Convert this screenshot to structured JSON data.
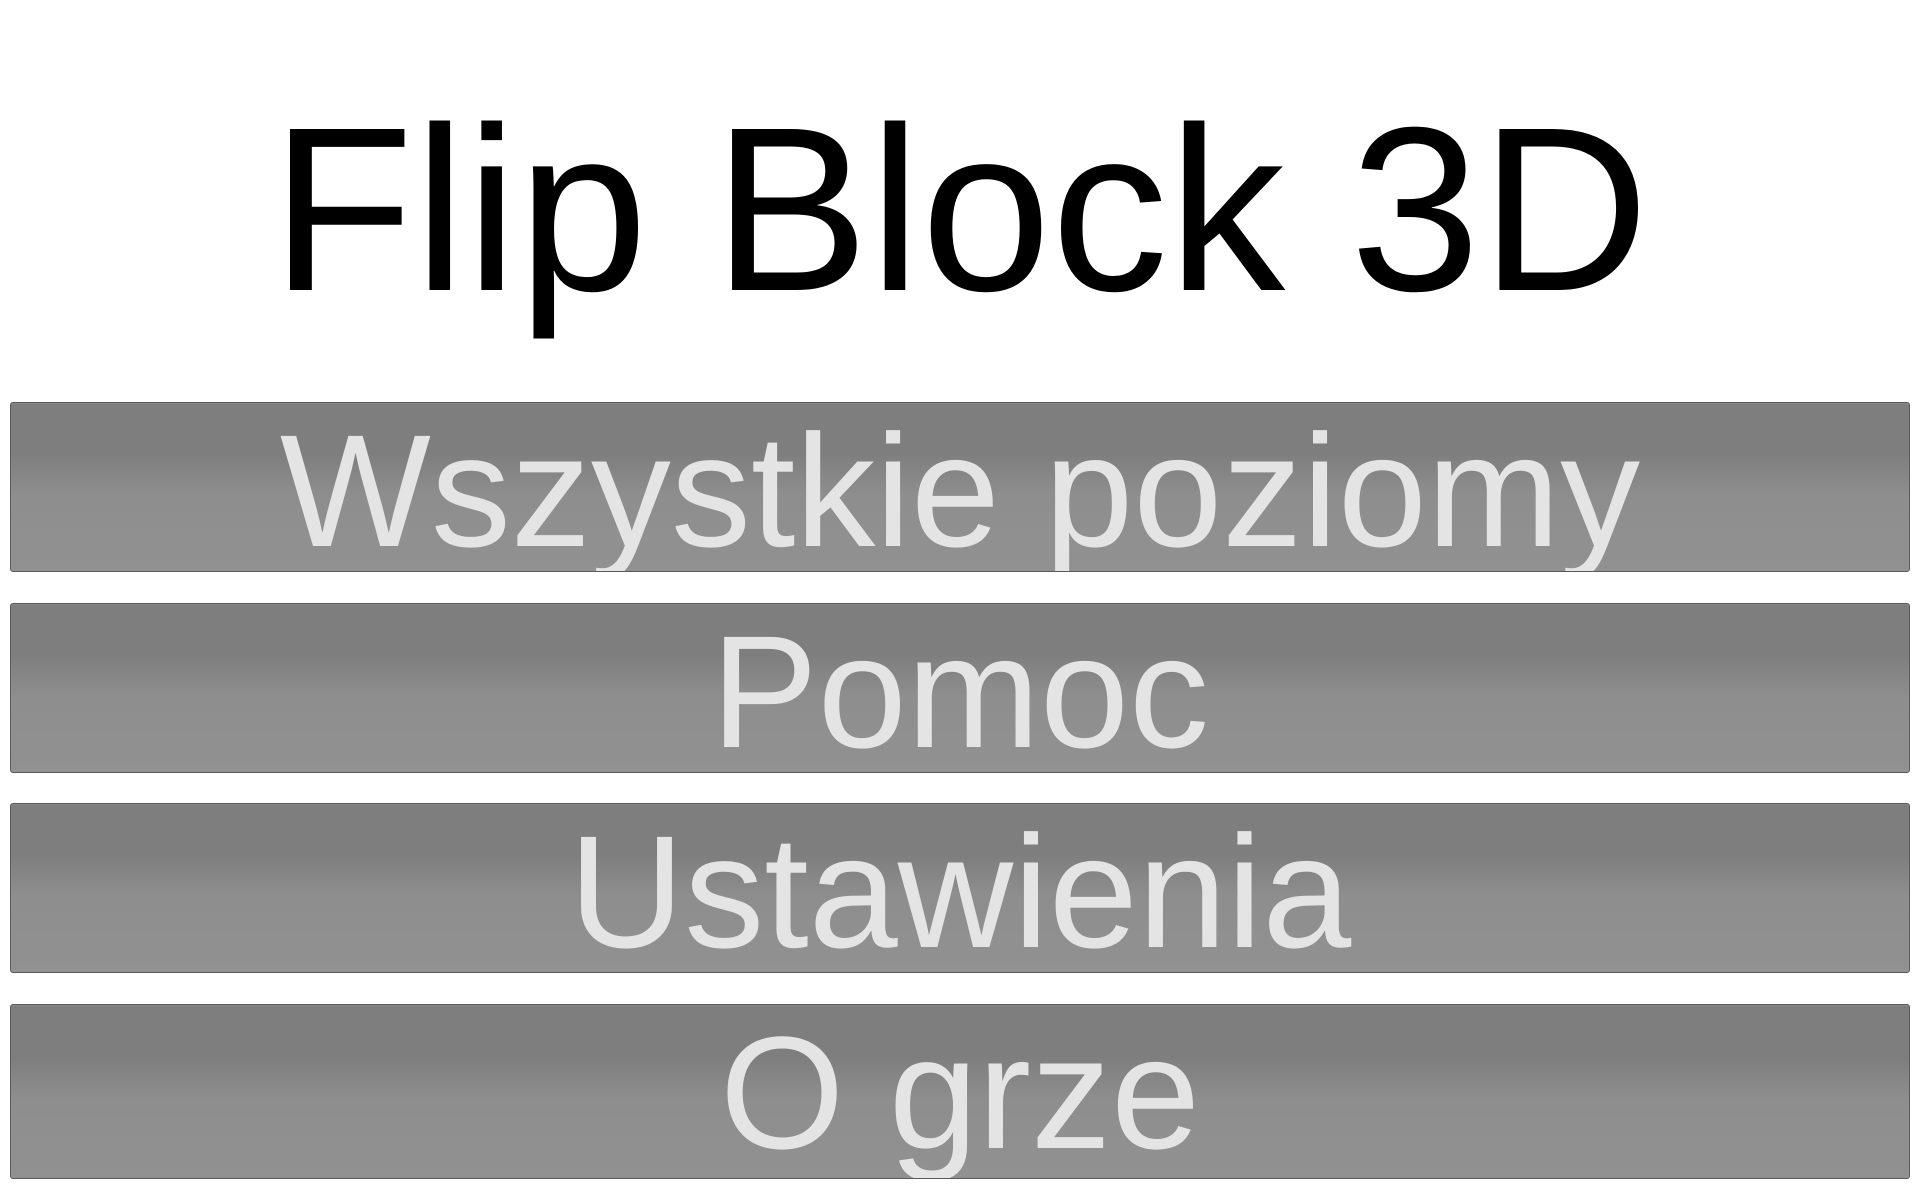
{
  "app": {
    "title": "Flip Block 3D"
  },
  "menu": {
    "items": [
      {
        "label": "Wszystkie poziomy"
      },
      {
        "label": "Pomoc"
      },
      {
        "label": "Ustawienia"
      },
      {
        "label": "O grze"
      }
    ]
  },
  "colors": {
    "background": "#ffffff",
    "title_text": "#000000",
    "button_bg_top": "#7e7e7e",
    "button_bg_bottom": "#919191",
    "button_text": "#e4e4e4"
  }
}
